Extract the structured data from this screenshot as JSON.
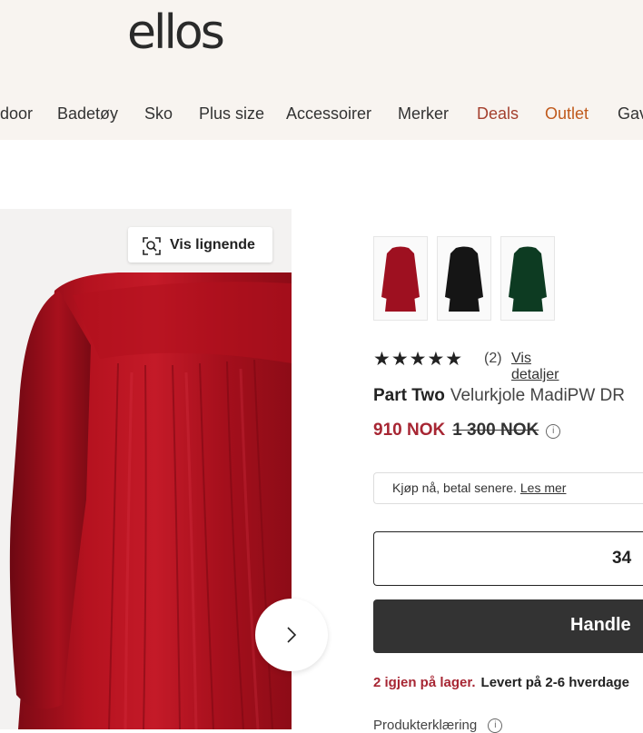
{
  "header": {
    "logo": "ellos",
    "nav": [
      {
        "label": "door"
      },
      {
        "label": "Badetøy"
      },
      {
        "label": "Sko"
      },
      {
        "label": "Plus size"
      },
      {
        "label": "Accessoirer"
      },
      {
        "label": "Merker"
      },
      {
        "label": "Deals",
        "color": "#a4402e"
      },
      {
        "label": "Outlet",
        "color": "#c05a1c"
      },
      {
        "label": "Gav"
      }
    ]
  },
  "gallery": {
    "similar_label": "Vis lignende",
    "similar_icon": "visual-search-icon",
    "next_icon": "chevron-right-icon",
    "dress_color": "#b0121f"
  },
  "variants": [
    {
      "name": "red",
      "color": "#9e1020"
    },
    {
      "name": "black",
      "color": "#151515"
    },
    {
      "name": "green",
      "color": "#0d3b22"
    }
  ],
  "rating": {
    "stars": "★★★★★",
    "value": 5,
    "count": "(2)",
    "details_link": "Vis detaljer"
  },
  "product": {
    "brand": "Part Two",
    "name": "Velurkjole MadiPW DR"
  },
  "price": {
    "current": "910 NOK",
    "original": "1 300 NOK",
    "info_icon": "info-icon"
  },
  "bnpl": {
    "text": "Kjøp nå, betal senere.",
    "link": "Les mer"
  },
  "size": {
    "selected": "34"
  },
  "buy": {
    "label": "Handle"
  },
  "stock": {
    "low_stock": "2 igjen på lager.",
    "delivery": "Levert på 2-6 hverdage"
  },
  "declaration": {
    "label": "Produkterklæring"
  },
  "colors": {
    "header_bg": "#f8f4f0",
    "sale_price": "#a72633",
    "button_bg": "#333333"
  }
}
